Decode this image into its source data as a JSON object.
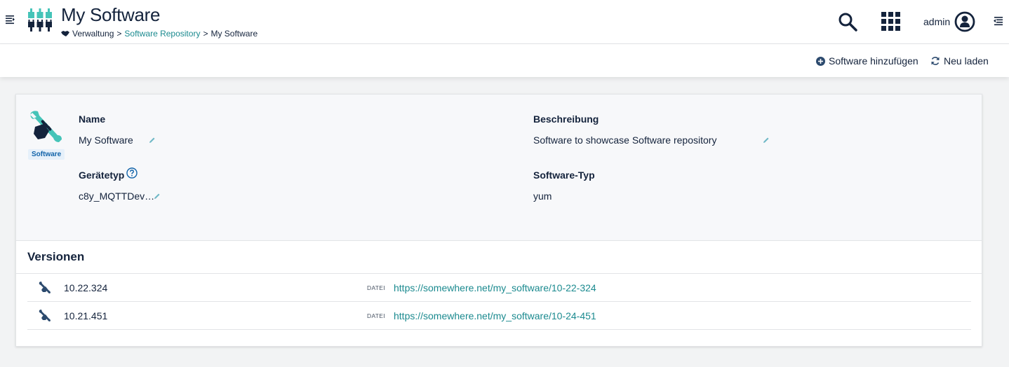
{
  "header": {
    "title": "My Software",
    "breadcrumb": {
      "icon": "handshake-icon",
      "items": [
        "Verwaltung",
        "Software Repository",
        "My Software"
      ],
      "separator": ">"
    },
    "user": "admin",
    "icons": [
      "menu-toggle-icon",
      "app-logo-icon",
      "search-icon",
      "app-switcher-icon",
      "user-icon",
      "right-drawer-icon"
    ]
  },
  "actions": {
    "add_software": "Software hinzufügen",
    "reload": "Neu laden"
  },
  "details": {
    "badge": "Software",
    "name_label": "Name",
    "name_value": "My Software",
    "description_label": "Beschreibung",
    "description_value": "Software to showcase Software repository",
    "device_type_label": "Gerätetyp",
    "device_type_value": "c8y_MQTTDev…",
    "software_type_label": "Software-Typ",
    "software_type_value": "yum"
  },
  "versions": {
    "title": "Versionen",
    "file_label": "DATEI",
    "rows": [
      {
        "version": "10.22.324",
        "url": "https://somewhere.net/my_software/10-22-324"
      },
      {
        "version": "10.21.451",
        "url": "https://somewhere.net/my_software/10-24-451"
      }
    ]
  },
  "colors": {
    "accent": "#1b8a8f",
    "primary_text": "#14233c",
    "logo_teal": "#45c4b8",
    "badge_bg": "#e6f0fa",
    "badge_text": "#1163a9"
  }
}
